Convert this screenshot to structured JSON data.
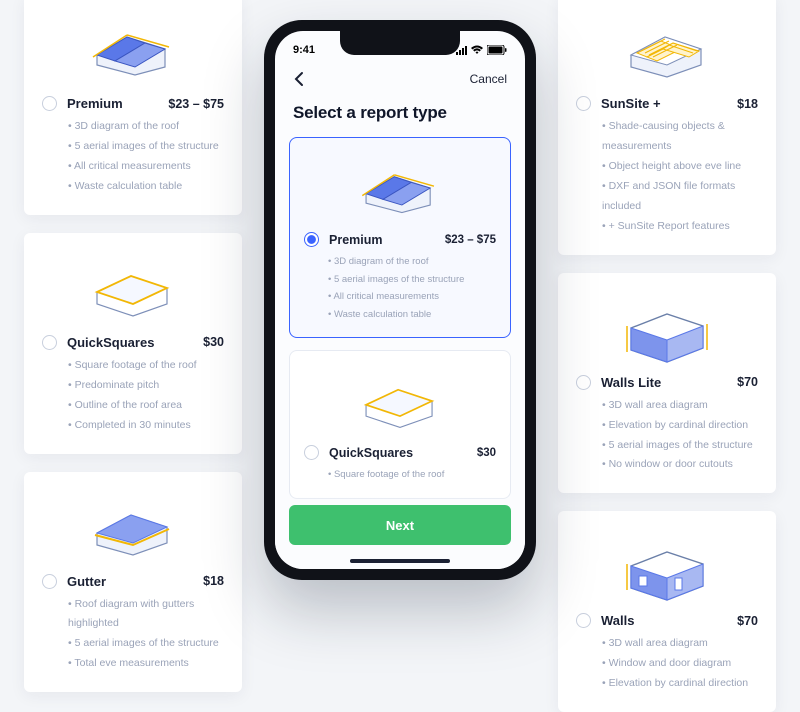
{
  "phone": {
    "time": "9:41",
    "cancel": "Cancel",
    "heading": "Select a report type",
    "next": "Next",
    "options": [
      {
        "name": "Premium",
        "price": "$23 – $75",
        "selected": true,
        "features": [
          "3D diagram of the roof",
          "5 aerial images of the structure",
          "All critical measurements",
          "Waste calculation table"
        ]
      },
      {
        "name": "QuickSquares",
        "price": "$30",
        "selected": false,
        "features": [
          "Square footage of the roof"
        ]
      }
    ]
  },
  "cards_left": [
    {
      "name": "Premium",
      "price": "$23 – $75",
      "features": [
        "3D diagram of the roof",
        "5 aerial images of the structure",
        "All critical measurements",
        "Waste calculation table"
      ],
      "icon": "roof"
    },
    {
      "name": "QuickSquares",
      "price": "$30",
      "features": [
        "Square footage of the roof",
        "Predominate pitch",
        "Outline of the roof area",
        "Completed in 30 minutes"
      ],
      "icon": "outline"
    },
    {
      "name": "Gutter",
      "price": "$18",
      "features": [
        "Roof diagram with gutters highlighted",
        "5 aerial images of the structure",
        "Total eve measurements"
      ],
      "icon": "gutter"
    }
  ],
  "cards_right": [
    {
      "name": "SunSite +",
      "price": "$18",
      "features": [
        "Shade-causing objects & measurements",
        "Object height above eve line",
        "DXF and JSON file formats included",
        "+ SunSite Report features"
      ],
      "icon": "solar"
    },
    {
      "name": "Walls Lite",
      "price": "$70",
      "features": [
        "3D wall area diagram",
        "Elevation by cardinal direction",
        "5 aerial images of the structure",
        "No window or door cutouts"
      ],
      "icon": "walls"
    },
    {
      "name": "Walls",
      "price": "$70",
      "features": [
        "3D wall area diagram",
        "Window and door diagram",
        "Elevation by cardinal direction"
      ],
      "icon": "walls2"
    }
  ]
}
